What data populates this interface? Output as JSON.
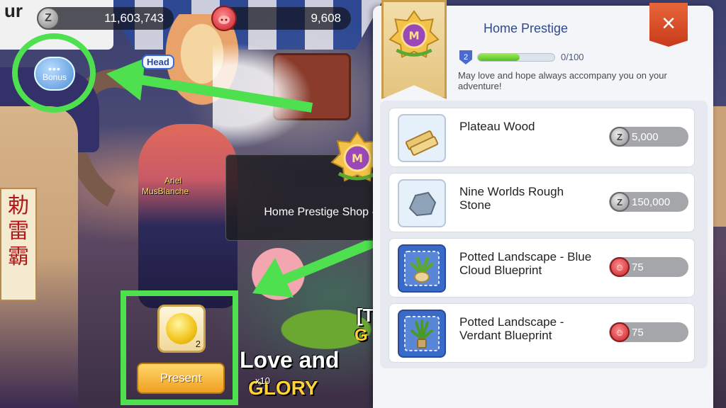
{
  "hud": {
    "zeny_symbol": "Z",
    "zeny_amount": "11,603,743",
    "rubies_amount": "9,608",
    "bonus_label": "Bonus",
    "corner_text": "ur"
  },
  "scene": {
    "head_tag": "Head",
    "name_ariel": "Ariel",
    "name_blanche": "MusBlanche",
    "chat_bracket": "[T",
    "chat_g": "G",
    "chat_love": "Love and",
    "chat_glory": "GLORY",
    "talisman": "勅雷霸",
    "x10_label": "x10"
  },
  "gift": {
    "apple_count": "2",
    "present_label": "Present"
  },
  "toast": {
    "message": "Home Prestige Shop - Added New Item"
  },
  "panel": {
    "title": "Home Prestige",
    "level": "2",
    "progress_text": "0/100",
    "progress_fraction": 0.55,
    "description": "May love and hope always accompany you on your adventure!",
    "close_label": "×",
    "items": [
      {
        "name": "Plateau Wood",
        "price": "5,000",
        "currency": "zeny",
        "icon": "wood-planks-icon"
      },
      {
        "name": "Nine Worlds Rough Stone",
        "price": "150,000",
        "currency": "zeny",
        "icon": "rough-stone-icon"
      },
      {
        "name": "Potted Landscape - Blue Cloud Blueprint",
        "price": "75",
        "currency": "ruby",
        "icon": "potted-plant-icon"
      },
      {
        "name": "Potted Landscape - Verdant Blueprint",
        "price": "75",
        "currency": "ruby",
        "icon": "potted-plant-icon"
      }
    ]
  },
  "colors": {
    "annotation_green": "#4ee04e",
    "title_blue": "#2f4a8a",
    "close_orange": "#d8502a",
    "progress_green": "#54c020"
  }
}
